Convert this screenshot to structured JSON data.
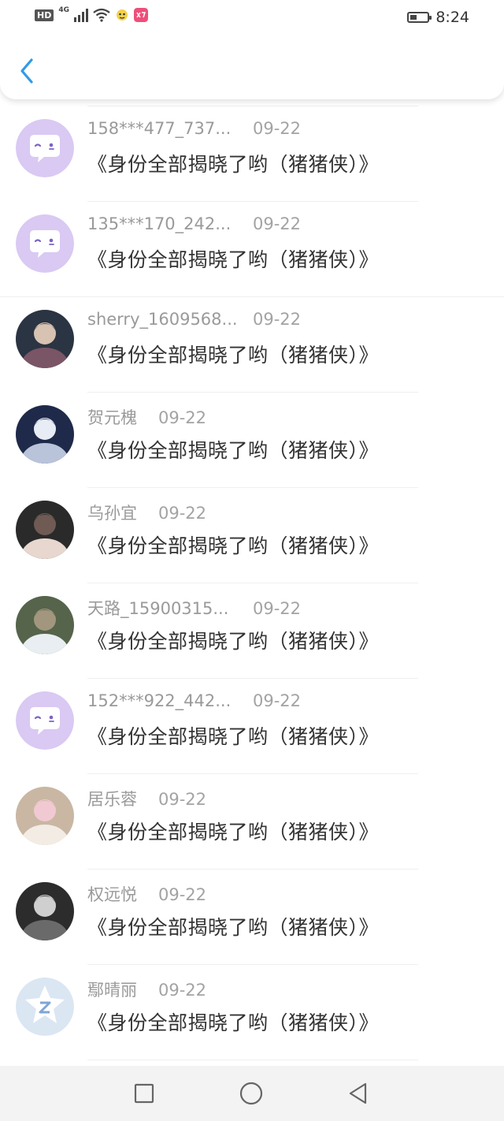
{
  "status_bar": {
    "hd": "HD",
    "network": "4G",
    "time": "8:24",
    "battery_level": 0.4,
    "icons": [
      "signal-icon",
      "wifi-icon",
      "app-notification-icon",
      "app-notification-icon-2",
      "battery-icon"
    ]
  },
  "header": {
    "back_icon": "chevron-left-icon"
  },
  "rows": [
    {
      "name": "",
      "date": "",
      "message": "《身份全部揭晓了哟（猪猪侠）》",
      "avatar": "photo"
    },
    {
      "name": "158***477_737...",
      "date": "09-22",
      "message": "《身份全部揭晓了哟（猪猪侠）》",
      "avatar": "default"
    },
    {
      "name": "135***170_242...",
      "date": "09-22",
      "message": "《身份全部揭晓了哟（猪猪侠）》",
      "avatar": "default"
    },
    {
      "name": "sherry_1609568...",
      "date": "09-22",
      "message": "《身份全部揭晓了哟（猪猪侠）》",
      "avatar": "photo"
    },
    {
      "name": "贺元槐",
      "date": "09-22",
      "message": "《身份全部揭晓了哟（猪猪侠）》",
      "avatar": "photo"
    },
    {
      "name": "乌孙宜",
      "date": "09-22",
      "message": "《身份全部揭晓了哟（猪猪侠）》",
      "avatar": "photo"
    },
    {
      "name": "天路_15900315...",
      "date": "09-22",
      "message": "《身份全部揭晓了哟（猪猪侠）》",
      "avatar": "photo"
    },
    {
      "name": "152***922_442...",
      "date": "09-22",
      "message": "《身份全部揭晓了哟（猪猪侠）》",
      "avatar": "default"
    },
    {
      "name": "居乐蓉",
      "date": "09-22",
      "message": "《身份全部揭晓了哟（猪猪侠）》",
      "avatar": "photo"
    },
    {
      "name": "权远悦",
      "date": "09-22",
      "message": "《身份全部揭晓了哟（猪猪侠）》",
      "avatar": "photo"
    },
    {
      "name": "鄢晴丽",
      "date": "09-22",
      "message": "《身份全部揭晓了哟（猪猪侠）》",
      "avatar": "qq-default"
    }
  ],
  "nav_bar": {
    "buttons": [
      "recent-apps-icon",
      "home-icon",
      "back-triangle-icon"
    ]
  },
  "colors": {
    "accent": "#2f9be8",
    "default_avatar_bg": "#d9c9f3",
    "default_avatar_fg": "#7b62c4",
    "qq_avatar_bg": "#dbe6f3"
  }
}
